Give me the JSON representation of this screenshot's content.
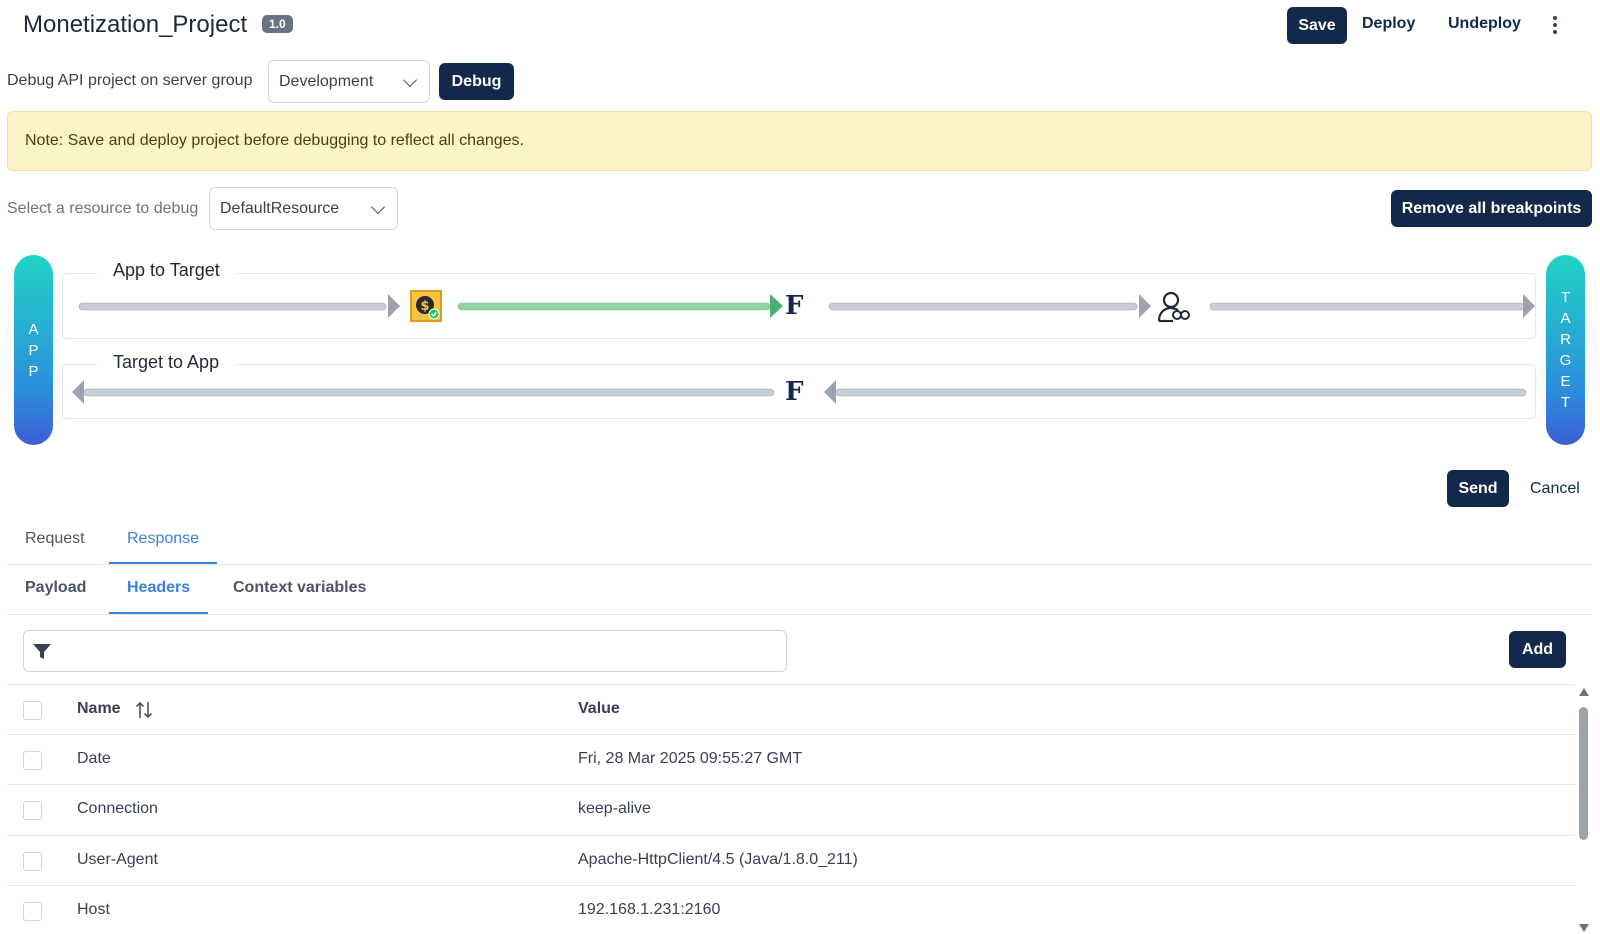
{
  "header": {
    "title": "Monetization_Project",
    "version": "1.0",
    "save_label": "Save",
    "deploy_label": "Deploy",
    "undeploy_label": "Undeploy",
    "more_icon": "kebab-menu-icon"
  },
  "debug": {
    "label": "Debug API project on server group",
    "server_group": "Development",
    "debug_label": "Debug"
  },
  "note": "Note: Save and deploy project before debugging to reflect all changes.",
  "resource": {
    "label": "Select a resource to debug",
    "selected": "DefaultResource",
    "remove_label": "Remove all breakpoints"
  },
  "flow": {
    "app_label": [
      "A",
      "P",
      "P"
    ],
    "target_label": [
      "T",
      "A",
      "R",
      "G",
      "E",
      "T"
    ],
    "app_to_target_title": "App to Target",
    "target_to_app_title": "Target to App",
    "f_glyph": "F",
    "dollar_glyph": "$",
    "colors": {
      "active_arrow": "#6cc287",
      "inactive_arrow": "#c9ced6",
      "brand": "#13294b"
    },
    "icons": [
      "monetization-policy-icon",
      "function-policy-icon",
      "user-credentials-icon",
      "function-policy-icon"
    ]
  },
  "actions": {
    "send_label": "Send",
    "cancel_label": "Cancel"
  },
  "tabs": {
    "main": [
      {
        "label": "Request"
      },
      {
        "label": "Response",
        "active": true
      }
    ],
    "sub": [
      {
        "label": "Payload"
      },
      {
        "label": "Headers",
        "active": true
      },
      {
        "label": "Context variables"
      }
    ]
  },
  "filter": {
    "placeholder": "",
    "add_label": "Add"
  },
  "table": {
    "columns": {
      "name": "Name",
      "value": "Value"
    },
    "rows": [
      {
        "name": "Date",
        "value": "Fri, 28 Mar 2025 09:55:27 GMT"
      },
      {
        "name": "Connection",
        "value": "keep-alive"
      },
      {
        "name": "User-Agent",
        "value": "Apache-HttpClient/4.5 (Java/1.8.0_211)"
      },
      {
        "name": "Host",
        "value": "192.168.1.231:2160"
      }
    ]
  }
}
